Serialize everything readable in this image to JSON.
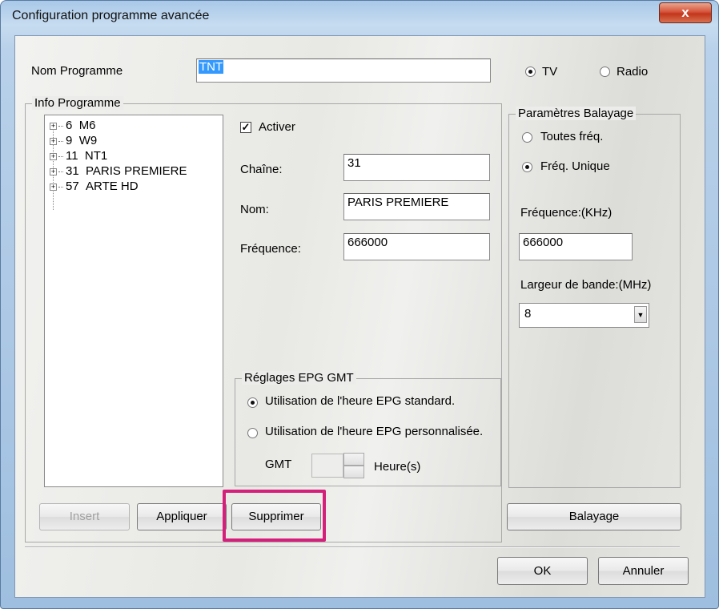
{
  "window": {
    "title": "Configuration programme avancée",
    "close_glyph": "x"
  },
  "nom_programme": {
    "label": "Nom Programme",
    "value": "TNT"
  },
  "mode": {
    "tv_label": "TV",
    "radio_label": "Radio",
    "selected": "TV"
  },
  "info_programme": {
    "legend": "Info Programme",
    "tree": [
      {
        "num": "6",
        "name": "M6"
      },
      {
        "num": "9",
        "name": "W9"
      },
      {
        "num": "11",
        "name": "NT1"
      },
      {
        "num": "31",
        "name": "PARIS PREMIERE"
      },
      {
        "num": "57",
        "name": "ARTE HD"
      }
    ]
  },
  "fields": {
    "activer_label": "Activer",
    "activer_checked": true,
    "chaine_label": "Chaîne:",
    "chaine_value": "31",
    "nom_label": "Nom:",
    "nom_value": "PARIS PREMIERE",
    "frequence_label": "Fréquence:",
    "frequence_value": "666000"
  },
  "epg": {
    "legend": "Réglages EPG GMT",
    "standard_label": "Utilisation de l'heure EPG standard.",
    "custom_label": "Utilisation de l'heure EPG personnalisée.",
    "gmt_label": "GMT",
    "heures_label": "Heure(s)"
  },
  "balayage": {
    "legend": "Paramètres Balayage",
    "toutes_label": "Toutes fréq.",
    "unique_label": "Fréq. Unique",
    "frequence_label": "Fréquence:(KHz)",
    "frequence_value": "666000",
    "bande_label": "Largeur de bande:(MHz)",
    "bande_value": "8"
  },
  "buttons": {
    "insert": "Insert",
    "appliquer": "Appliquer",
    "supprimer": "Supprimer",
    "balayage": "Balayage",
    "ok": "OK",
    "annuler": "Annuler"
  },
  "colors": {
    "highlight": "#d4207a",
    "close": "#c8432a"
  }
}
